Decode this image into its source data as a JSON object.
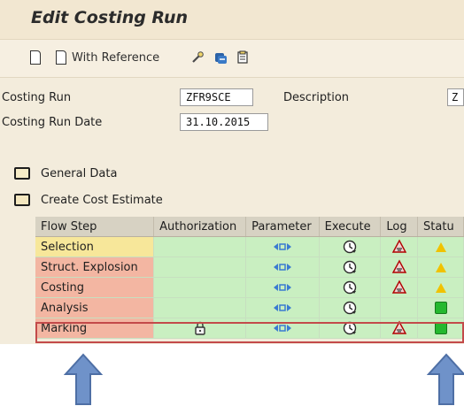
{
  "window": {
    "title": "Edit Costing Run"
  },
  "toolbar": {
    "new_icon": "document-icon",
    "with_reference_label": "With Reference",
    "tool_icons": [
      "wrench-icon",
      "copy-icon",
      "clipboard-icon"
    ]
  },
  "form": {
    "costing_run_label": "Costing Run",
    "costing_run_value": "ZFR9SCE",
    "description_label": "Description",
    "description_value": "Z",
    "costing_run_date_label": "Costing Run Date",
    "costing_run_date_value": "31.10.2015"
  },
  "sections": {
    "general_data": "General Data",
    "create_cost_estimate": "Create Cost Estimate"
  },
  "table": {
    "columns": [
      "Flow Step",
      "Authorization",
      "Parameter",
      "Execute",
      "Log",
      "Statu"
    ],
    "rows": [
      {
        "flow_step": "Selection",
        "authorization": "",
        "parameter_icon": "parameter-icon",
        "execute_icon": "execute-icon",
        "log_icon": "log-icon",
        "status_icon": "warning-triangle-icon"
      },
      {
        "flow_step": "Struct. Explosion",
        "authorization": "",
        "parameter_icon": "parameter-icon",
        "execute_icon": "execute-icon",
        "log_icon": "log-icon",
        "status_icon": "warning-triangle-icon"
      },
      {
        "flow_step": "Costing",
        "authorization": "",
        "parameter_icon": "parameter-icon",
        "execute_icon": "execute-icon",
        "log_icon": "log-icon",
        "status_icon": "warning-triangle-icon"
      },
      {
        "flow_step": "Analysis",
        "authorization": "",
        "parameter_icon": "parameter-icon",
        "execute_icon": "execute-icon",
        "log_icon": "",
        "status_icon": "green-square-icon"
      },
      {
        "flow_step": "Marking",
        "authorization": "lock-icon",
        "parameter_icon": "parameter-icon",
        "execute_icon": "execute-icon",
        "log_icon": "log-icon",
        "status_icon": "green-square-icon"
      }
    ]
  },
  "colors": {
    "green": "#c9efc1",
    "yellow": "#f7e79a",
    "red": "#f3b6a2",
    "highlight": "#c34a4a",
    "arrow": "#6f92c9"
  }
}
